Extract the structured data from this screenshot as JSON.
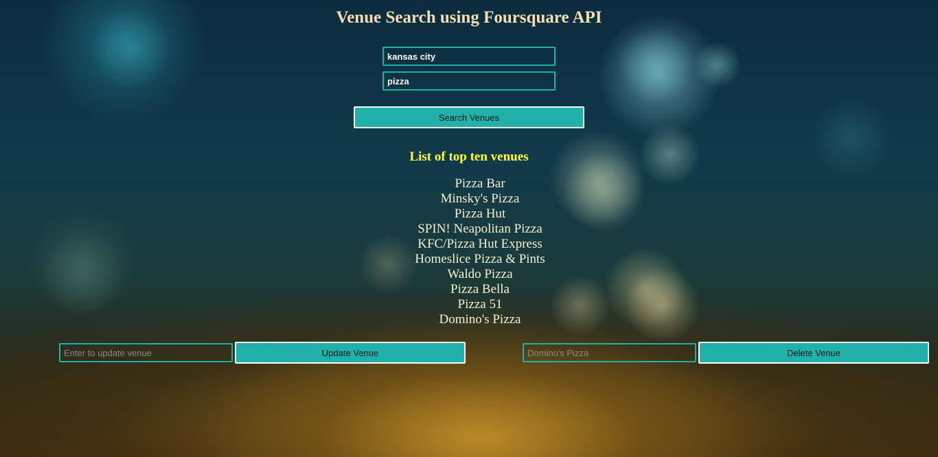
{
  "page": {
    "title": "Venue Search using Foursquare API"
  },
  "search": {
    "city_value": "kansas city",
    "query_value": "pizza",
    "search_button_label": "Search Venues"
  },
  "results": {
    "heading": "List of top ten venues",
    "venues": [
      "Pizza Bar",
      "Minsky's Pizza",
      "Pizza Hut",
      "SPIN! Neapolitan Pizza",
      "KFC/Pizza Hut Express",
      "Homeslice Pizza & Pints",
      "Waldo Pizza",
      "Pizza Bella",
      "Pizza 51",
      "Domino's Pizza"
    ]
  },
  "update": {
    "placeholder": "Enter to update venue",
    "button_label": "Update Venue"
  },
  "delete": {
    "placeholder": "Domino's Pizza",
    "button_label": "Delete Venue"
  },
  "colors": {
    "accent": "#20b2aa",
    "title": "#f5deb3",
    "heading": "#ffff33",
    "venue_text": "#f5f0d0"
  }
}
